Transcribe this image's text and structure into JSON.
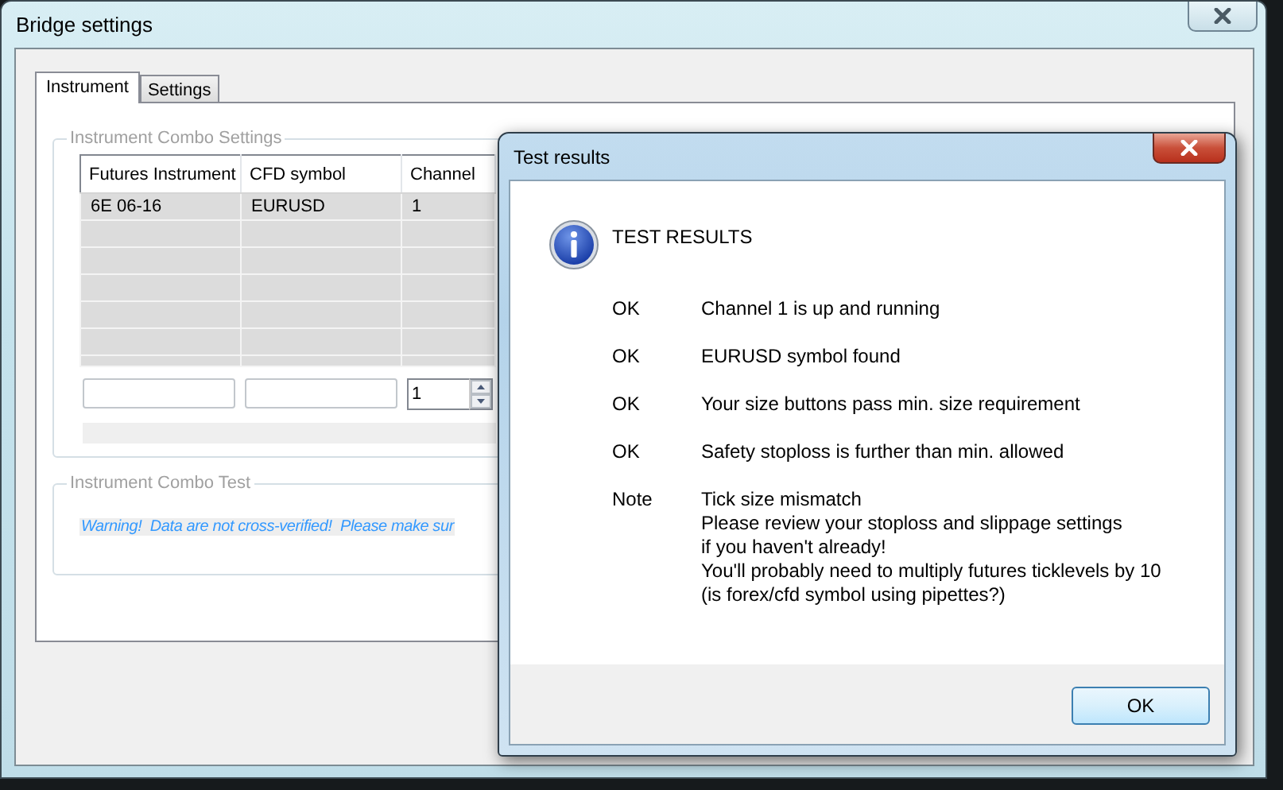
{
  "window": {
    "title": "Bridge settings"
  },
  "tabs": [
    {
      "label": "Instrument",
      "selected": true
    },
    {
      "label": "Settings",
      "selected": false
    }
  ],
  "combo_settings": {
    "title": "Instrument Combo Settings",
    "table": {
      "columns": [
        "Futures Instrument",
        "CFD symbol",
        "Channel"
      ],
      "rows": [
        [
          "6E 06-16",
          "EURUSD",
          "1"
        ]
      ]
    },
    "fields": [
      {
        "kind": "text"
      },
      {
        "kind": "text"
      },
      {
        "kind": "spin",
        "value": "1"
      }
    ]
  },
  "combo_test": {
    "title": "Instrument Combo Test",
    "warning": "Warning!  Data are not cross-verified!  Please make sur"
  },
  "dialog": {
    "title": "Test results",
    "heading": "TEST RESULTS",
    "results": [
      {
        "status": "OK",
        "lines": [
          "Channel 1 is up and running"
        ]
      },
      {
        "status": "OK",
        "lines": [
          "EURUSD symbol found"
        ]
      },
      {
        "status": "OK",
        "lines": [
          "Your size buttons pass min. size requirement"
        ]
      },
      {
        "status": "OK",
        "lines": [
          "Safety stoploss is further than min. allowed"
        ]
      },
      {
        "status": "Note",
        "lines": [
          "Tick size mismatch",
          "Please review your stoploss and slippage settings",
          "if you haven't already!",
          "You'll probably need to multiply futures ticklevels by 10",
          "(is forex/cfd symbol using pipettes?)"
        ]
      }
    ],
    "button": "OK"
  }
}
